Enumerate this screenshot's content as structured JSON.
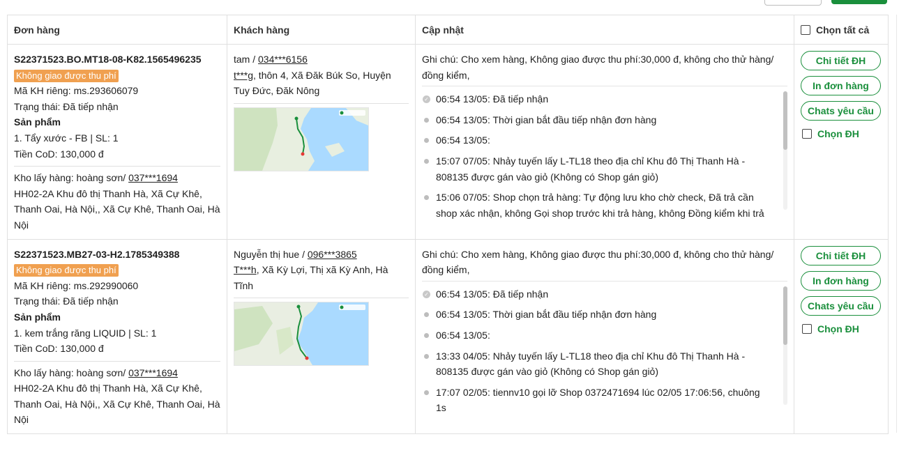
{
  "header": {
    "col_order": "Đơn hàng",
    "col_customer": "Khách hàng",
    "col_update": "Cập nhật",
    "select_all": "Chọn tất cả"
  },
  "actions": {
    "detail": "Chi tiết ĐH",
    "print": "In đơn hàng",
    "chat": "Chats yêu cầu",
    "select": "Chọn ĐH"
  },
  "orders": [
    {
      "code": "S22371523.BO.MT18-08-K82.1565496235",
      "tag": "Không giao được thu phí",
      "customer_code": "Mã KH riêng: ms.293606079",
      "status": "Trạng thái: Đã tiếp nhận",
      "products_label": "Sản phẩm",
      "product": "1. Tẩy xước - FB | SL: 1",
      "cod": "Tiền CoD: 130,000 đ",
      "pickup_prefix": "Kho lấy hàng: hoàng sơn/ ",
      "pickup_phone": "037***1694",
      "pickup_address": "HH02-2A Khu đô thị Thanh Hà, Xã Cự Khê, Thanh Oai, Hà Nội,, Xã Cự Khê, Thanh Oai, Hà Nội",
      "customer_name": "tam / ",
      "customer_phone": "034***6156",
      "customer_addr_masked": "t***g",
      "customer_addr_rest": ", thôn 4, Xã Đăk Búk So, Huyện Tuy Đức, Đăk Nông",
      "note": "Ghi chú: Cho xem hàng, Không giao được thu phí:30,000 đ, không cho thử hàng/ đồng kiểm,",
      "history": [
        "06:54 13/05: Đã tiếp nhận",
        "06:54 13/05: Thời gian bắt đầu tiếp nhận đơn hàng",
        "06:54 13/05:",
        "15:07 07/05: Nhảy tuyến lấy L-TL18 theo địa chỉ Khu đô Thị Thanh Hà - 808135 được gán vào giỏ (Không có Shop gán giỏ)",
        "15:06 07/05: Shop chọn trả hàng: Tự động lưu kho chờ check, Đã trả cần shop xác nhận, không Gọi shop trước khi trả hàng, không Đồng kiểm khi trả"
      ]
    },
    {
      "code": "S22371523.MB27-03-H2.1785349388",
      "tag": "Không giao được thu phí",
      "customer_code": "Mã KH riêng: ms.292990060",
      "status": "Trạng thái: Đã tiếp nhận",
      "products_label": "Sản phẩm",
      "product": "1. kem trắng răng LIQUID | SL: 1",
      "cod": "Tiền CoD: 130,000 đ",
      "pickup_prefix": "Kho lấy hàng: hoàng sơn/ ",
      "pickup_phone": "037***1694",
      "pickup_address": "HH02-2A Khu đô thị Thanh Hà, Xã Cự Khê, Thanh Oai, Hà Nội,, Xã Cự Khê, Thanh Oai, Hà Nội",
      "customer_name": "Nguyễn thị hue / ",
      "customer_phone": "096***3865",
      "customer_addr_masked": "T***h",
      "customer_addr_rest": ", Xã Kỳ Lợi, Thị xã Kỳ Anh, Hà Tĩnh",
      "note": "Ghi chú: Cho xem hàng, Không giao được thu phí:30,000 đ, không cho thử hàng/ đồng kiểm,",
      "history": [
        "06:54 13/05: Đã tiếp nhận",
        "06:54 13/05: Thời gian bắt đầu tiếp nhận đơn hàng",
        "06:54 13/05:",
        "13:33 04/05: Nhảy tuyến lấy L-TL18 theo địa chỉ Khu đô Thị Thanh Hà - 808135 được gán vào giỏ (Không có Shop gán giỏ)",
        "17:07 02/05: tiennv10 gọi lỡ Shop 0372471694 lúc 02/05 17:06:56, chuông 1s"
      ]
    }
  ],
  "colors": {
    "primary": "#1a8f3c",
    "tag": "#f0a050",
    "border": "#e0e0e0"
  }
}
